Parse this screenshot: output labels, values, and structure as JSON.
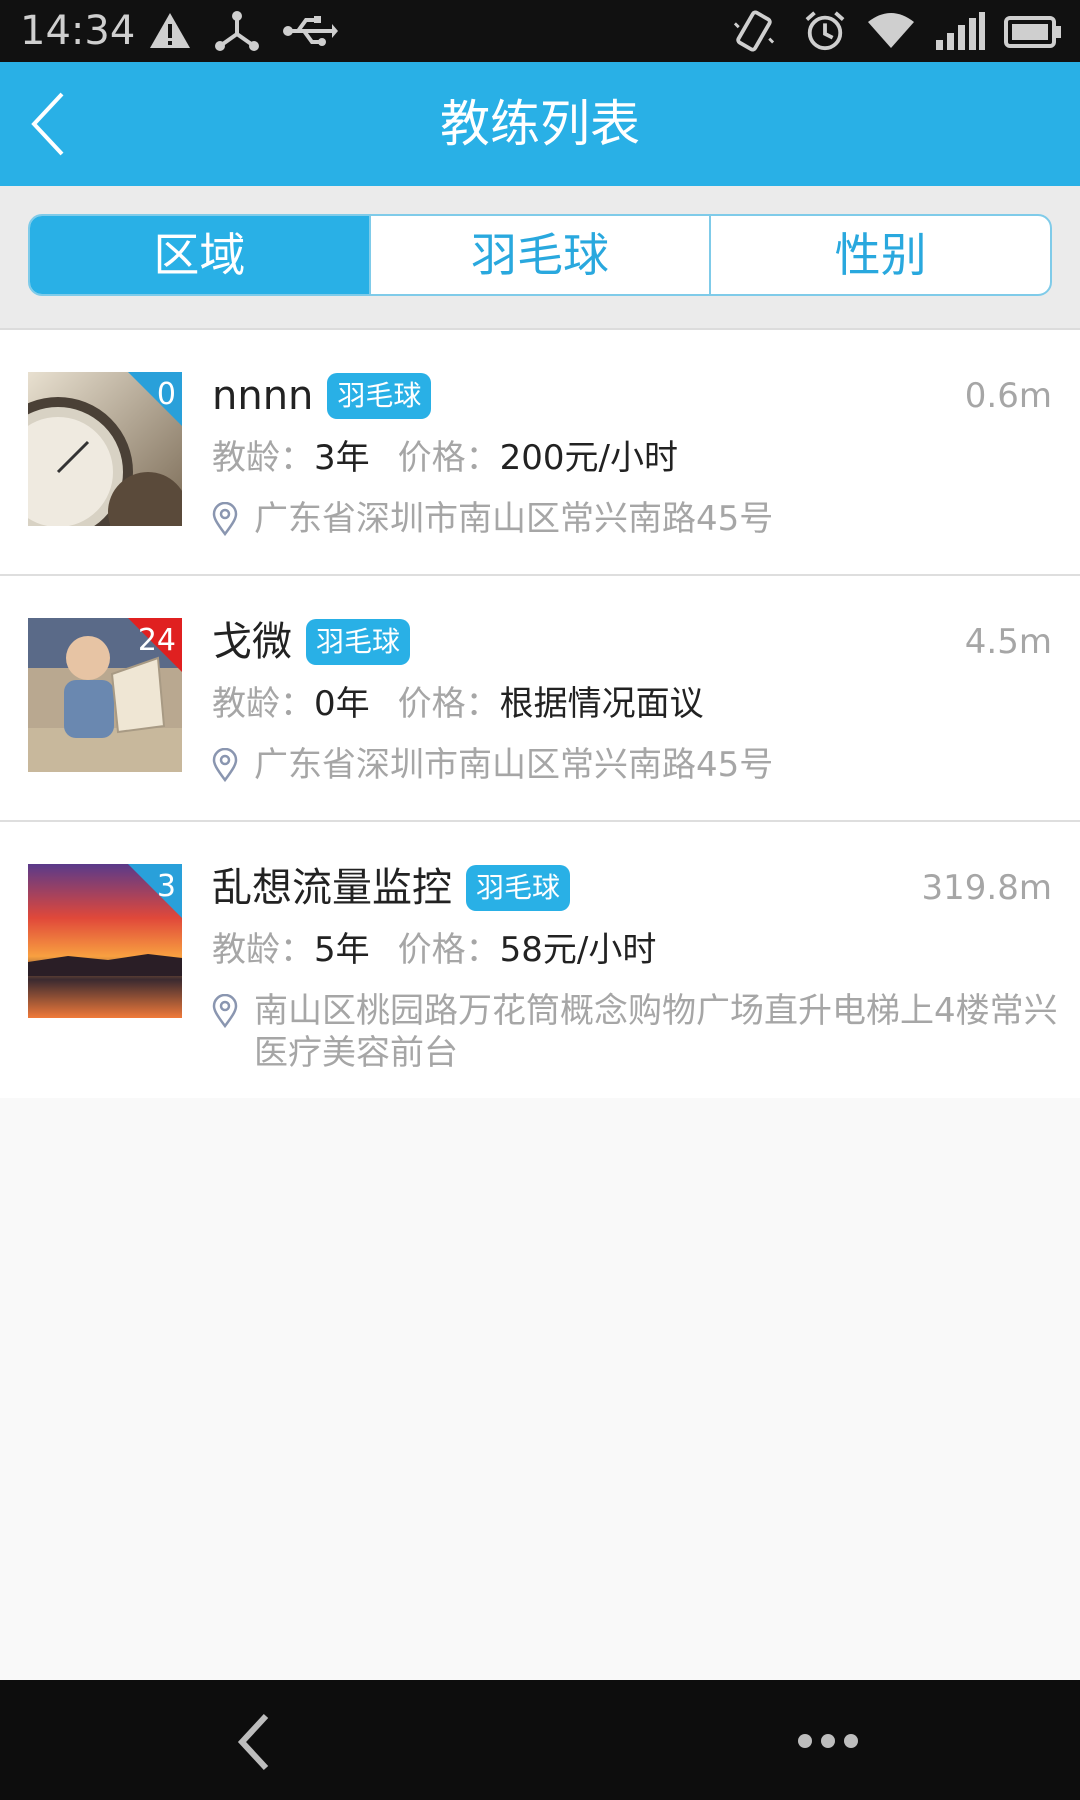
{
  "status_bar": {
    "time": "14:34",
    "icons": [
      "warning-icon",
      "share-icon",
      "usb-icon",
      "vibrate-icon",
      "alarm-icon",
      "wifi-icon",
      "signal-icon",
      "battery-icon"
    ]
  },
  "header": {
    "title": "教练列表",
    "back_icon": "back-arrow-icon"
  },
  "filters": {
    "tabs": [
      {
        "label": "区域",
        "active": true
      },
      {
        "label": "羽毛球",
        "active": false
      },
      {
        "label": "性别",
        "active": false
      }
    ]
  },
  "coaches": [
    {
      "name": "nnnn",
      "sport_tag": "羽毛球",
      "count": "0",
      "distance": "0.6m",
      "experience_label": "教龄：",
      "experience": "3年",
      "price_label": "价格：",
      "price": "200元/小时",
      "address": "广东省深圳市南山区常兴南路45号"
    },
    {
      "name": "戈微",
      "sport_tag": "羽毛球",
      "count": "24",
      "distance": "4.5m",
      "experience_label": "教龄：",
      "experience": "0年",
      "price_label": "价格：",
      "price": "根据情况面议",
      "address": "广东省深圳市南山区常兴南路45号"
    },
    {
      "name": "乱想流量监控",
      "sport_tag": "羽毛球",
      "count": "3",
      "distance": "319.8m",
      "experience_label": "教龄：",
      "experience": "5年",
      "price_label": "价格：",
      "price": "58元/小时",
      "address": "南山区桃园路万花筒概念购物广场直升电梯上4楼常兴医疗美容前台"
    }
  ],
  "colors": {
    "accent": "#29b0e6",
    "badge_blue": "#29a0da",
    "badge_red": "#e02020",
    "text_dark": "#222222",
    "text_gray": "#a6a6a6"
  }
}
